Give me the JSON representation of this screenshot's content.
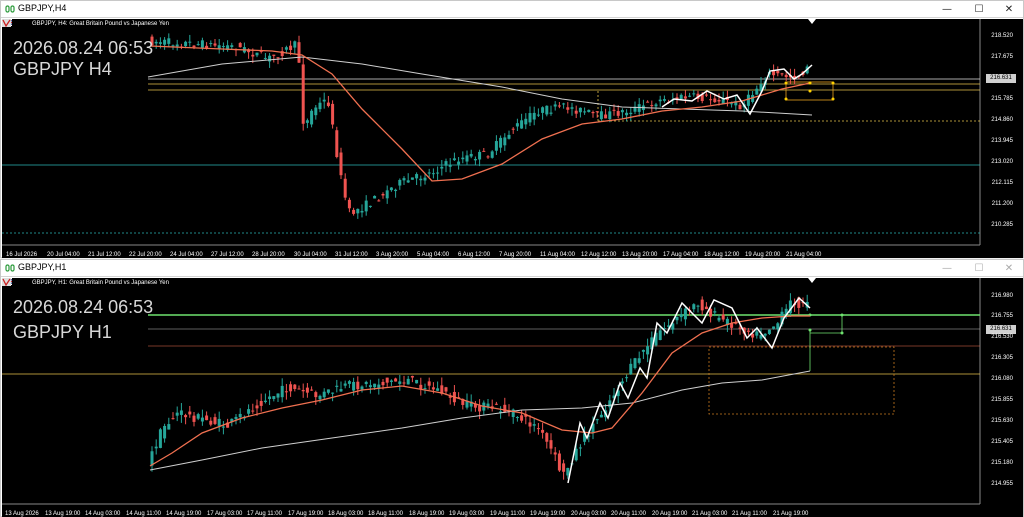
{
  "window_top": {
    "title": "GBPJPY,H4",
    "symbol_description": "GBPJPY, H4:  Great Britain Pound vs Japanese Yen",
    "overlay_datetime": "2026.08.24 06:53",
    "overlay_symbol": "GBPJPY H4",
    "current_price": "216.631",
    "y_ticks": [
      "218.520",
      "217.675",
      "216.631",
      "215.785",
      "214.860",
      "213.945",
      "213.020",
      "212.115",
      "211.200",
      "210.285"
    ],
    "x_ticks": [
      "16 Jul 2026",
      "20 Jul 04:00",
      "21 Jul 12:00",
      "22 Jul 20:00",
      "24 Jul 04:00",
      "27 Jul 12:00",
      "28 Jul 20:00",
      "30 Jul 04:00",
      "31 Jul 12:00",
      "3 Aug 20:00",
      "5 Aug 04:00",
      "6 Aug 12:00",
      "7 Aug 20:00",
      "11 Aug 04:00",
      "12 Aug 12:00",
      "13 Aug 20:00",
      "17 Aug 04:00",
      "18 Aug 12:00",
      "19 Aug 20:00",
      "21 Aug 04:00"
    ]
  },
  "window_bottom": {
    "title": "GBPJPY,H1",
    "symbol_description": "GBPJPY, H1:  Great Britain Pound vs Japanese Yen",
    "overlay_datetime": "2026.08.24 06:53",
    "overlay_symbol": "GBPJPY H1",
    "current_price": "216.631",
    "y_ticks": [
      "216.980",
      "216.755",
      "216.631",
      "216.530",
      "216.305",
      "216.080",
      "215.855",
      "215.630",
      "215.405",
      "215.180",
      "214.955"
    ],
    "x_ticks": [
      "13 Aug 2026",
      "13 Aug 19:00",
      "14 Aug 03:00",
      "14 Aug 11:00",
      "14 Aug 19:00",
      "17 Aug 03:00",
      "17 Aug 11:00",
      "17 Aug 19:00",
      "18 Aug 03:00",
      "18 Aug 11:00",
      "18 Aug 19:00",
      "19 Aug 03:00",
      "19 Aug 11:00",
      "19 Aug 19:00",
      "20 Aug 03:00",
      "20 Aug 11:00",
      "20 Aug 19:00",
      "21 Aug 03:00",
      "21 Aug 11:00",
      "21 Aug 19:00"
    ]
  },
  "colors": {
    "bull": "#26a69a",
    "bear": "#ef5350",
    "ma_fast": "#f07050",
    "ma_slow": "#cfcfcf",
    "level_gold": "#e6c24a",
    "level_cyan": "#2bb5b5",
    "level_green": "#6fe26f"
  },
  "icons": [
    "app-icon",
    "minimize-icon",
    "maximize-icon",
    "close-icon",
    "uk-flag-icon",
    "chart-type-icon"
  ]
}
